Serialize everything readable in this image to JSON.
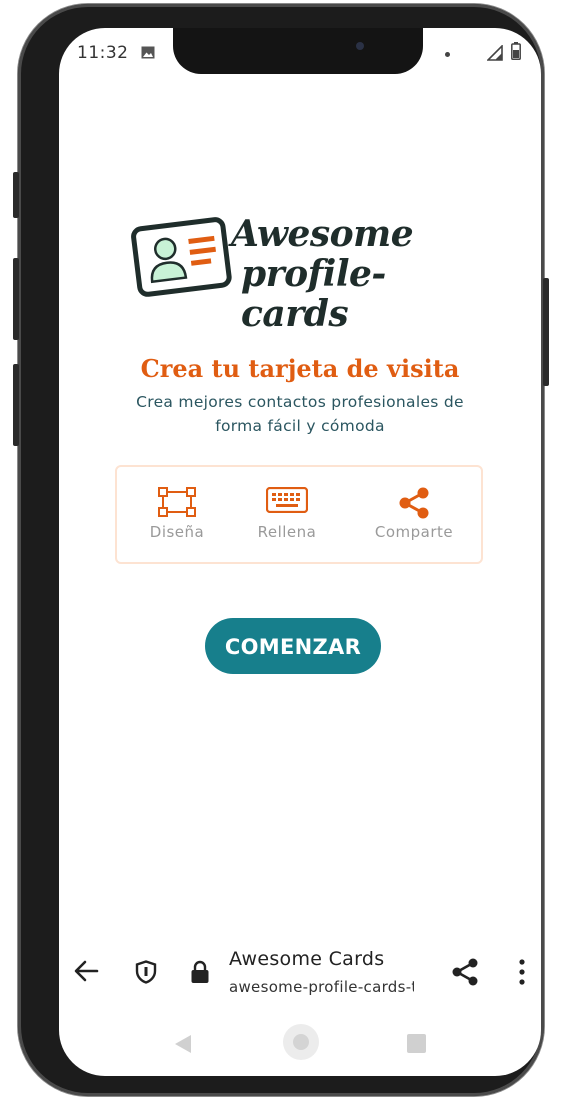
{
  "status_bar": {
    "time": "11:32"
  },
  "logo": {
    "line1": "Awesome",
    "line2": "profile-cards"
  },
  "hero": {
    "headline": "Crea tu tarjeta de visita",
    "subtitle": "Crea mejores contactos profesionales de forma fácil y cómoda"
  },
  "features": [
    {
      "label": "Diseña",
      "icon": "design-icon"
    },
    {
      "label": "Rellena",
      "icon": "keyboard-icon"
    },
    {
      "label": "Comparte",
      "icon": "share-icon"
    }
  ],
  "cta": {
    "label": "COMENZAR"
  },
  "browser_bar": {
    "title": "Awesome Cards",
    "url": "awesome-profile-cards-tc"
  },
  "colors": {
    "accent_orange": "#e05d12",
    "primary_teal": "#177f8c",
    "text_teal": "#2b5660"
  }
}
